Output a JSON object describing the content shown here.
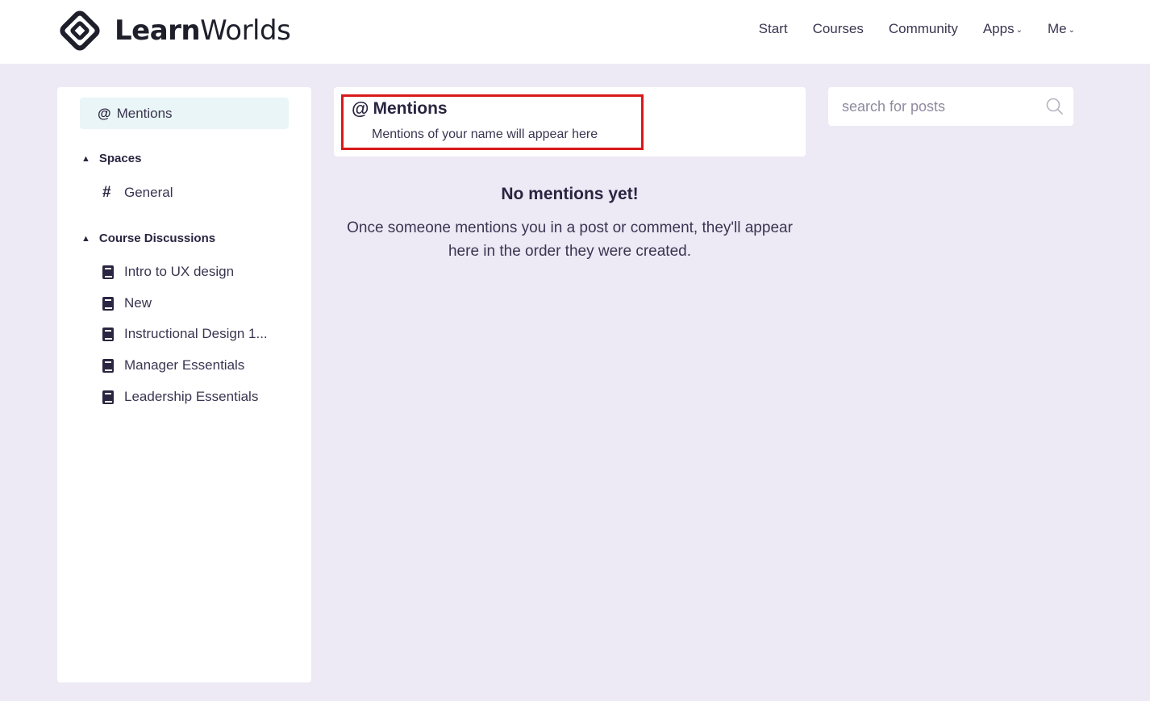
{
  "brand": {
    "name_bold": "Learn",
    "name_light": "Worlds"
  },
  "nav": {
    "items": [
      {
        "label": "Start",
        "dropdown": false
      },
      {
        "label": "Courses",
        "dropdown": false
      },
      {
        "label": "Community",
        "dropdown": false
      },
      {
        "label": "Apps",
        "dropdown": true
      },
      {
        "label": "Me",
        "dropdown": true
      }
    ]
  },
  "sidebar": {
    "mentions_label": "Mentions",
    "spaces": {
      "title": "Spaces",
      "items": [
        {
          "label": "General",
          "icon": "hash-icon"
        }
      ]
    },
    "course_discussions": {
      "title": "Course Discussions",
      "items": [
        {
          "label": "Intro to UX design",
          "icon": "book-icon"
        },
        {
          "label": "New",
          "icon": "book-icon"
        },
        {
          "label": "Instructional Design 1...",
          "icon": "book-icon"
        },
        {
          "label": "Manager Essentials",
          "icon": "book-icon"
        },
        {
          "label": "Leadership Essentials",
          "icon": "book-icon"
        }
      ]
    }
  },
  "main": {
    "title": "Mentions",
    "subtitle": "Mentions of your name will appear here",
    "empty_title": "No mentions yet!",
    "empty_desc_line1": "Once someone mentions you in a post or comment, they'll appear",
    "empty_desc_line2": "here in the order they were created."
  },
  "search": {
    "placeholder": "search for posts"
  },
  "colors": {
    "background": "#edeaf6",
    "highlight": "#d91919",
    "active_pill": "#e9f5f6",
    "text": "#2a2540"
  }
}
